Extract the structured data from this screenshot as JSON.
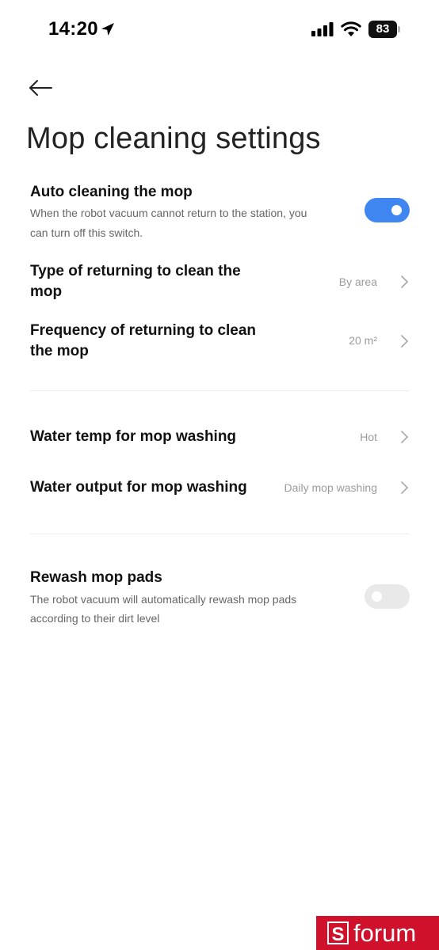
{
  "status_bar": {
    "time": "14:20",
    "battery_percent": "83",
    "location_icon": "location-arrow-icon",
    "signal_icon": "cellular-signal-icon",
    "wifi_icon": "wifi-icon"
  },
  "header": {
    "back_icon": "arrow-left-icon",
    "title": "Mop cleaning settings"
  },
  "settings": {
    "auto_clean": {
      "title": "Auto cleaning the mop",
      "description_line1": "When the robot vacuum cannot return to the station, you",
      "description_line2": "can turn off this switch.",
      "enabled": true
    },
    "return_type": {
      "title_line1": "Type of returning to clean the",
      "title_line2": "mop",
      "value": "By area"
    },
    "return_frequency": {
      "title_line1": "Frequency of returning to clean",
      "title_line2": "the mop",
      "value": "20 m²"
    },
    "water_temp": {
      "title": "Water temp for mop washing",
      "value": "Hot"
    },
    "water_output": {
      "title": "Water output for mop washing",
      "value": "Daily mop washing"
    },
    "rewash": {
      "title": "Rewash mop pads",
      "description_line1": "The robot vacuum will automatically rewash mop pads",
      "description_line2": "according to their dirt level",
      "enabled": false
    }
  },
  "colors": {
    "accent": "#3f86f0",
    "toggle_off": "#e9e9e9",
    "watermark": "#d0112b"
  },
  "watermark": {
    "letter": "S",
    "text": "forum"
  }
}
